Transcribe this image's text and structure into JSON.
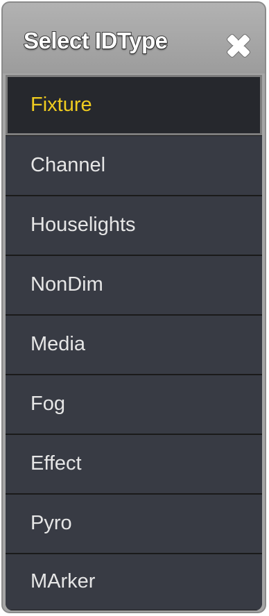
{
  "dialog": {
    "title": "Select IDType",
    "close_icon": "close-icon"
  },
  "colors": {
    "selected_text": "#f0cc1f",
    "item_text": "#e6e6e6",
    "item_bg": "#383b44",
    "selected_bg": "#26282d",
    "title_bar": "#a6a6a6"
  },
  "items": [
    {
      "label": "Fixture",
      "selected": true
    },
    {
      "label": "Channel",
      "selected": false
    },
    {
      "label": "Houselights",
      "selected": false
    },
    {
      "label": "NonDim",
      "selected": false
    },
    {
      "label": "Media",
      "selected": false
    },
    {
      "label": "Fog",
      "selected": false
    },
    {
      "label": "Effect",
      "selected": false
    },
    {
      "label": "Pyro",
      "selected": false
    },
    {
      "label": "MArker",
      "selected": false
    }
  ]
}
